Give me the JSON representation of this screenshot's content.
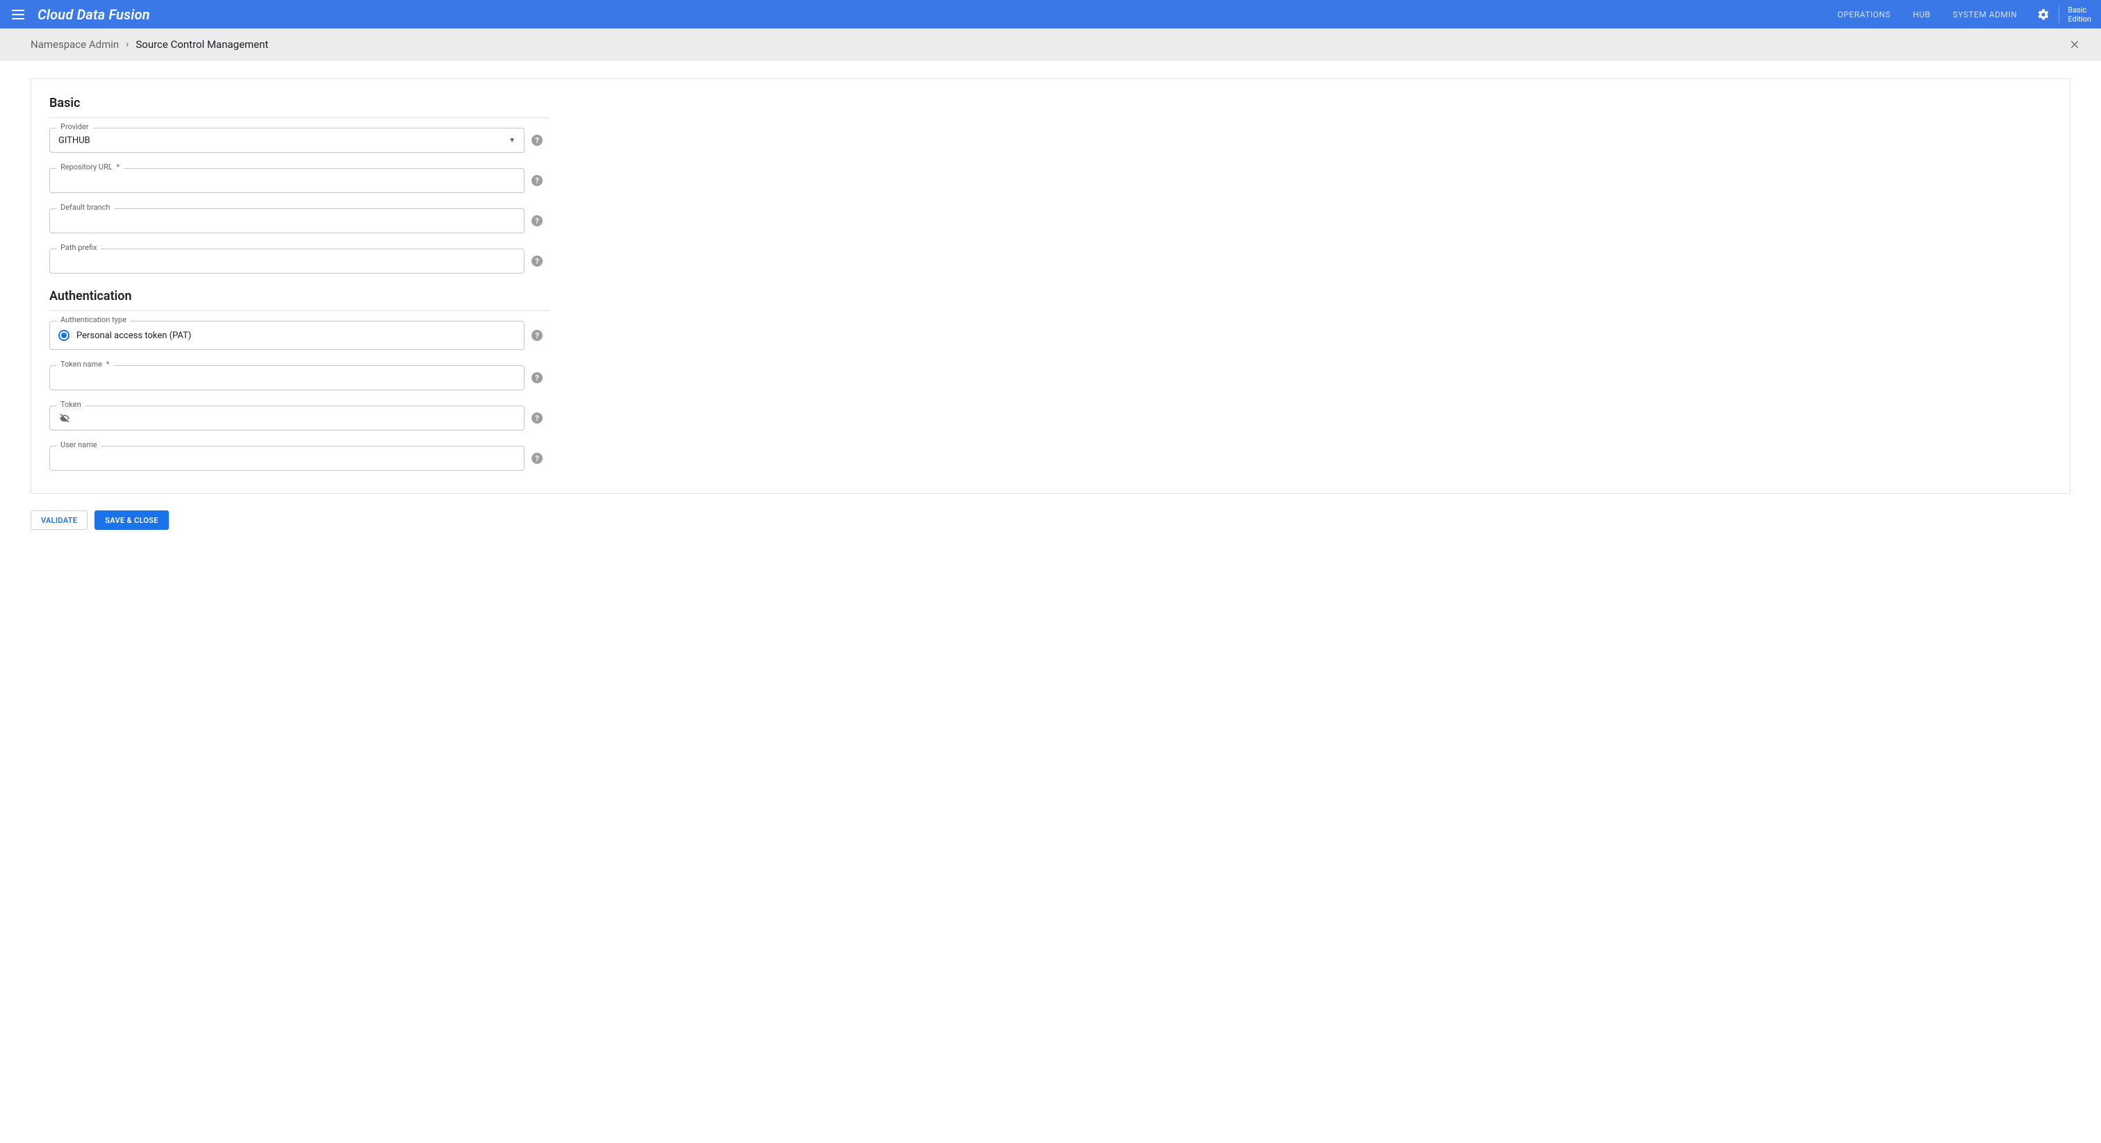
{
  "header": {
    "app_title": "Cloud Data Fusion",
    "nav": {
      "operations": "OPERATIONS",
      "hub": "HUB",
      "system_admin": "SYSTEM ADMIN"
    },
    "edition_line1": "Basic",
    "edition_line2": "Edition"
  },
  "breadcrumb": {
    "parent": "Namespace Admin",
    "current": "Source Control Management"
  },
  "sections": {
    "basic_title": "Basic",
    "auth_title": "Authentication"
  },
  "fields": {
    "provider": {
      "label": "Provider",
      "value": "GITHUB"
    },
    "repo_url": {
      "label": "Repository URL",
      "required_marker": "*",
      "value": ""
    },
    "default_branch": {
      "label": "Default branch",
      "value": ""
    },
    "path_prefix": {
      "label": "Path prefix",
      "value": ""
    },
    "auth_type": {
      "label": "Authentication type",
      "option_pat": "Personal access token (PAT)"
    },
    "token_name": {
      "label": "Token name",
      "required_marker": "*",
      "value": ""
    },
    "token": {
      "label": "Token",
      "value": ""
    },
    "user_name": {
      "label": "User name",
      "value": ""
    }
  },
  "buttons": {
    "validate": "VALIDATE",
    "save_close": "SAVE & CLOSE"
  },
  "icons": {
    "help": "?"
  }
}
